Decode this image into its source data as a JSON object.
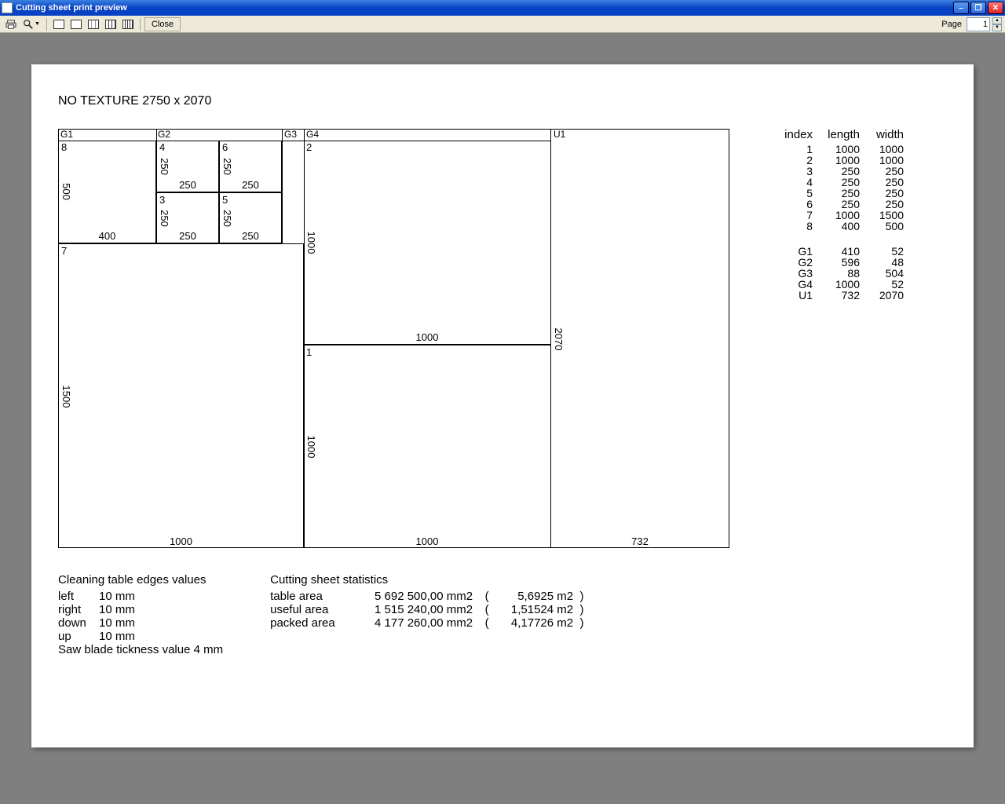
{
  "window": {
    "title": "Cutting sheet print preview",
    "page_label": "Page",
    "page_number": "1",
    "close_label": "Close"
  },
  "sheet": {
    "title": "NO TEXTURE 2750 x 2070",
    "strips_top": {
      "G1": "G1",
      "G2": "G2",
      "G3": "G3",
      "G4": "G4",
      "U1": "U1"
    },
    "pieces": {
      "p1": {
        "idx": "1",
        "w": "1000",
        "h": "1000"
      },
      "p2": {
        "idx": "2",
        "w": "1000",
        "h": "1000"
      },
      "p3": {
        "idx": "3",
        "w": "250",
        "h": "250"
      },
      "p4": {
        "idx": "4",
        "w": "250",
        "h": "250"
      },
      "p5": {
        "idx": "5",
        "w": "250",
        "h": "250"
      },
      "p6": {
        "idx": "6",
        "w": "250",
        "h": "250"
      },
      "p7": {
        "idx": "7",
        "w": "1000",
        "h": "1500"
      },
      "p8": {
        "idx": "8",
        "w": "400",
        "h": "500"
      },
      "u1": {
        "w": "732",
        "h": "2070"
      }
    }
  },
  "table": {
    "headers": {
      "index": "index",
      "length": "length",
      "width": "width"
    },
    "rows": [
      {
        "index": "1",
        "length": "1000",
        "width": "1000"
      },
      {
        "index": "2",
        "length": "1000",
        "width": "1000"
      },
      {
        "index": "3",
        "length": "250",
        "width": "250"
      },
      {
        "index": "4",
        "length": "250",
        "width": "250"
      },
      {
        "index": "5",
        "length": "250",
        "width": "250"
      },
      {
        "index": "6",
        "length": "250",
        "width": "250"
      },
      {
        "index": "7",
        "length": "1000",
        "width": "1500"
      },
      {
        "index": "8",
        "length": "400",
        "width": "500"
      }
    ],
    "grows": [
      {
        "index": "G1",
        "length": "410",
        "width": "52"
      },
      {
        "index": "G2",
        "length": "596",
        "width": "48"
      },
      {
        "index": "G3",
        "length": "88",
        "width": "504"
      },
      {
        "index": "G4",
        "length": "1000",
        "width": "52"
      },
      {
        "index": "U1",
        "length": "732",
        "width": "2070"
      }
    ]
  },
  "edges": {
    "title": "Cleaning table edges values",
    "left_l": "left",
    "left_v": "10 mm",
    "right_l": "right",
    "right_v": "10 mm",
    "down_l": "down",
    "down_v": "10 mm",
    "up_l": "up",
    "up_v": "10 mm",
    "blade": "Saw blade tickness value 4 mm"
  },
  "stats": {
    "title": "Cutting sheet statistics",
    "rows": [
      {
        "l": "table area",
        "mm2": "5 692 500,00 mm2",
        "p1": "(",
        "m2": "5,6925 m2",
        "p2": ")"
      },
      {
        "l": "useful area",
        "mm2": "1 515 240,00 mm2",
        "p1": "(",
        "m2": "1,51524 m2",
        "p2": ")"
      },
      {
        "l": "packed area",
        "mm2": "4 177 260,00 mm2",
        "p1": "(",
        "m2": "4,17726 m2",
        "p2": ")"
      }
    ]
  }
}
